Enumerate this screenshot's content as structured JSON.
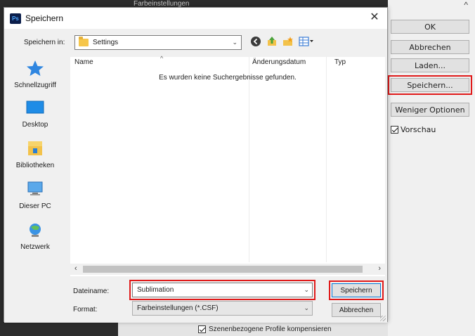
{
  "background": {
    "title_strip": "Farbeinstellungen",
    "buttons": [
      "OK",
      "Abbrechen",
      "Laden...",
      "Speichern...",
      "Weniger Optionen"
    ],
    "preview_label": "Vorschau",
    "bottom_hint": "Szenenbezogene Profile kompensieren"
  },
  "dialog": {
    "app_icon": "Ps",
    "title": "Speichern",
    "save_in_label": "Speichern in:",
    "save_in_value": "Settings",
    "places": [
      "Schnellzugriff",
      "Desktop",
      "Bibliotheken",
      "Dieser PC",
      "Netzwerk"
    ],
    "columns": [
      "Name",
      "Änderungsdatum",
      "Typ"
    ],
    "empty_message": "Es wurden keine Suchergebnisse gefunden.",
    "filename_label": "Dateiname:",
    "filename_value": "Sublimation",
    "format_label": "Format:",
    "format_value": "Farbeinstellungen (*.CSF)",
    "save_button": "Speichern",
    "cancel_button": "Abbrechen"
  },
  "colors": {
    "highlight": "#e01a1a",
    "accent": "#0078d7"
  },
  "icons": {
    "title": "photoshop-icon",
    "close": "close-icon",
    "folder": "folder-icon",
    "toolbar": [
      "back-icon",
      "up-folder-icon",
      "new-folder-icon",
      "view-menu-icon"
    ],
    "places": [
      "star-icon",
      "desktop-icon",
      "library-icon",
      "computer-icon",
      "network-icon"
    ]
  }
}
